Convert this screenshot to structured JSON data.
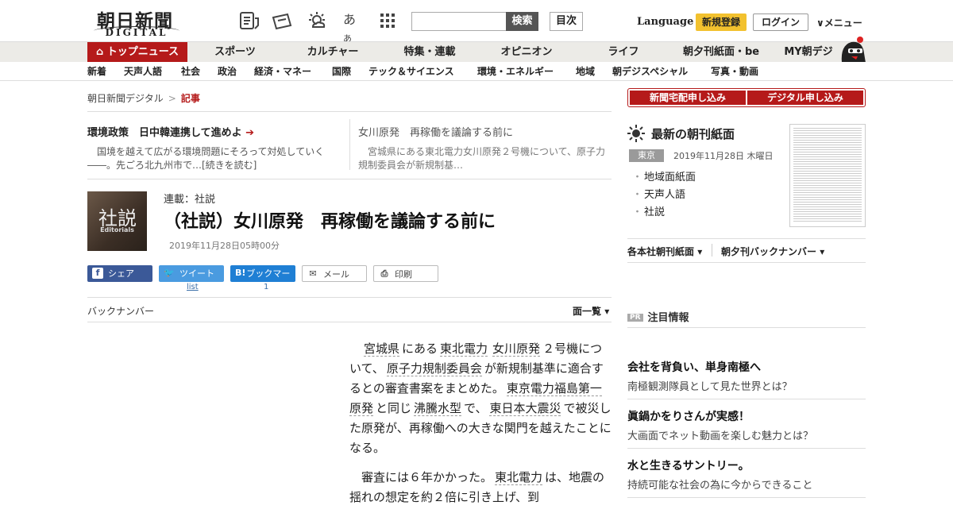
{
  "header": {
    "logo_jp": "朝日新聞",
    "logo_en": "DIGITAL",
    "search_button": "検索",
    "search_placeholder": "",
    "toc_button": "目次",
    "language": "Language",
    "register": "新規登録",
    "login": "ログイン",
    "menu": "∨メニュー"
  },
  "nav_main": [
    "トップニュース",
    "スポーツ",
    "カルチャー",
    "特集・連載",
    "オピニオン",
    "ライフ",
    "朝夕刊紙面・be",
    "MY朝デジ"
  ],
  "nav_sub": [
    "新着",
    "天声人語",
    "社会",
    "政治",
    "経済・マネー",
    "国際",
    "テック＆サイエンス",
    "環境・エネルギー",
    "地域",
    "朝デジスペシャル",
    "写真・動画"
  ],
  "breadcrumb": {
    "home": "朝日新聞デジタル",
    "sep": ">",
    "current": "記事"
  },
  "picks": [
    {
      "title": "環境政策　日中韓連携して進めよ",
      "desc": "国境を越えて広がる環境問題にそろって対処していく――。先ごろ北九州市で…[続きを読む]"
    },
    {
      "title": "女川原発　再稼働を議論する前に",
      "desc": "宮城県にある東北電力女川原発２号機について、原子力規制委員会が新規制基…"
    }
  ],
  "article": {
    "thumb_kanji": "社説",
    "thumb_en": "Editorials",
    "series": "連載：社説",
    "headline": "（社説）女川原発　再稼働を議論する前に",
    "date": "2019年11月28日05時00分"
  },
  "share": {
    "facebook": "シェア",
    "twitter": "ツイート",
    "hatena": "ブックマーク",
    "mail": "メール",
    "print": "印刷",
    "twitter_count": "list",
    "hatena_count": "1"
  },
  "backnumber": "バックナンバー",
  "list_all": "一覧",
  "list_all_prefix": "面",
  "body": {
    "p1": [
      "宮城県",
      "にある",
      "東北電力",
      "女川原発",
      "２号機について、",
      "原子力規制委員会",
      "が新規制基準に適合するとの審査書案をまとめた。",
      "東京電力福島第一原発",
      "と同じ",
      "沸騰水型",
      "で、",
      "東日本大震災",
      "で被災した原発が、再稼働への大きな関門を越えたことになる。"
    ],
    "p2": [
      "審査には６年かかった。",
      "東北電力",
      "は、地震の揺れの想定を約２倍に引き上げ、到"
    ]
  },
  "side": {
    "btn_home": "新聞宅配申し込み",
    "btn_digital": "デジタル申し込み",
    "paper_title": "最新の朝刊紙面",
    "location": "東京",
    "paper_date": "2019年11月28日 木曜日",
    "paper_links": [
      "地域面紙面",
      "天声人語",
      "社説"
    ],
    "dd1": "各本社朝刊紙面",
    "dd2": "朝夕刊バックナンバー",
    "pr_tag": "PR",
    "pr_title": "注目情報",
    "ads": [
      {
        "title": "会社を背負い、単身南極へ",
        "sub": "南極観測隊員として見た世界とは？"
      },
      {
        "title": "眞鍋かをりさんが実感！",
        "sub": "大画面でネット動画を楽しむ魅力とは？"
      },
      {
        "title": "水と生きるサントリー。",
        "sub": "持続可能な社会の為に今からできること"
      }
    ]
  },
  "colors": {
    "brand_red": "#b51a1a",
    "register_yellow": "#f2c12e"
  }
}
